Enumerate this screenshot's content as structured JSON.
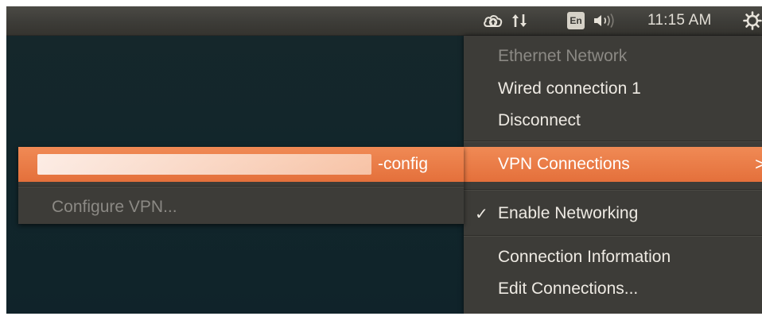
{
  "topbar": {
    "indicators": [
      {
        "name": "cloud-upload-icon"
      },
      {
        "name": "network-updown-icon"
      }
    ],
    "keyboard_layout": "En",
    "volume_icon": "volume-icon",
    "clock": "11:15 AM",
    "power_icon": "power-gear-icon"
  },
  "network_menu": {
    "section_header": "Ethernet Network",
    "wired_connection": "Wired connection 1",
    "disconnect": "Disconnect",
    "vpn_connections": "VPN Connections",
    "vpn_arrow": ">",
    "enable_networking": "Enable Networking",
    "enable_networking_check": "✓",
    "connection_information": "Connection Information",
    "edit_connections": "Edit Connections..."
  },
  "vpn_submenu": {
    "connection_suffix": "-config",
    "configure_vpn": "Configure VPN..."
  },
  "colors": {
    "panel": "#3d3c38",
    "highlight": "#e4703b",
    "desktop": "#13272c"
  }
}
